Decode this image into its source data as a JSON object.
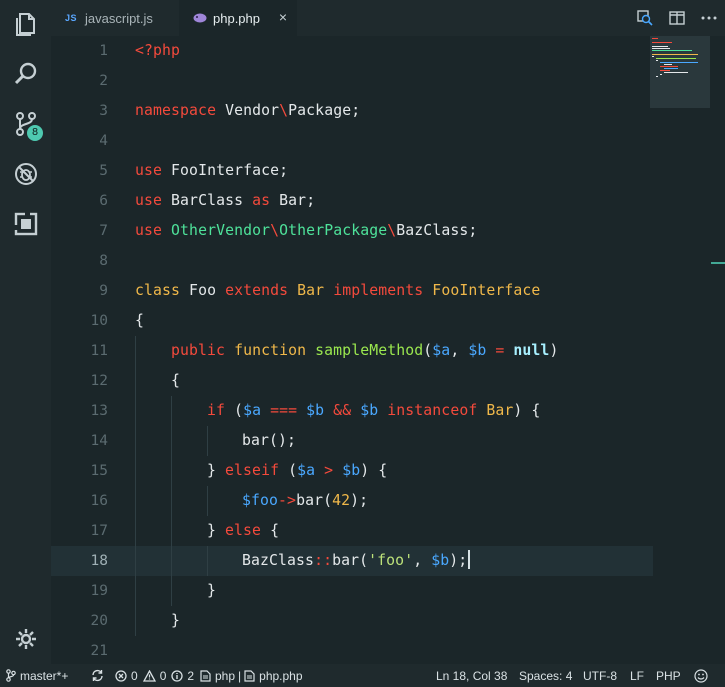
{
  "tabs": [
    {
      "icon": "JS",
      "label": "javascript.js",
      "active": false
    },
    {
      "label": "php.php",
      "active": true,
      "close": "×"
    }
  ],
  "activity": {
    "scm_badge": "8"
  },
  "editor": {
    "lines": [
      {
        "n": "1"
      },
      {
        "n": "2"
      },
      {
        "n": "3"
      },
      {
        "n": "4"
      },
      {
        "n": "5"
      },
      {
        "n": "6"
      },
      {
        "n": "7"
      },
      {
        "n": "8"
      },
      {
        "n": "9"
      },
      {
        "n": "10"
      },
      {
        "n": "11"
      },
      {
        "n": "12"
      },
      {
        "n": "13"
      },
      {
        "n": "14"
      },
      {
        "n": "15"
      },
      {
        "n": "16"
      },
      {
        "n": "17"
      },
      {
        "n": "18"
      },
      {
        "n": "19"
      },
      {
        "n": "20"
      },
      {
        "n": "21"
      }
    ],
    "code": {
      "l1": "<?php",
      "l3_ns": "namespace",
      "l3_name": " Vendor",
      "l3_sep": "\\",
      "l3_pkg": "Package;",
      "l5_use": "use",
      "l5_name": " FooInterface;",
      "l6_use": "use",
      "l6_name": " BarClass ",
      "l6_as": "as",
      "l6_alias": " Bar;",
      "l7_use": "use",
      "l7_a": " OtherVendor",
      "l7_s1": "\\",
      "l7_b": "OtherPackage",
      "l7_s2": "\\",
      "l7_c": "BazClass;",
      "l9_class": "class",
      "l9_name": " Foo ",
      "l9_extends": "extends",
      "l9_bar": " Bar ",
      "l9_impl": "implements",
      "l9_iface": " FooInterface",
      "l10": "{",
      "l11_pub": "public",
      "l11_fn": " function ",
      "l11_name": "sampleMethod",
      "l11_p1": "(",
      "l11_a": "$a",
      "l11_c": ", ",
      "l11_b": "$b",
      "l11_eq": " = ",
      "l11_null": "null",
      "l11_p2": ")",
      "l12": "{",
      "l13_if": "if",
      "l13_p": " (",
      "l13_a": "$a",
      "l13_op": " === ",
      "l13_b": "$b",
      "l13_and": " && ",
      "l13_b2": "$b",
      "l13_inst": " instanceof",
      "l13_bar": " Bar",
      "l13_end": ") {",
      "l14": "bar();",
      "l15_close": "} ",
      "l15_elseif": "elseif",
      "l15_p": " (",
      "l15_a": "$a",
      "l15_op": " > ",
      "l15_b": "$b",
      "l15_end": ") {",
      "l16_foo": "$foo",
      "l16_arrow": "->",
      "l16_bar": "bar(",
      "l16_num": "42",
      "l16_end": ");",
      "l17_close": "} ",
      "l17_else": "else",
      "l17_end": " {",
      "l18_cls": "BazClass",
      "l18_dc": "::",
      "l18_bar": "bar(",
      "l18_str": "'foo'",
      "l18_c": ", ",
      "l18_b": "$b",
      "l18_end": ");",
      "l19": "}",
      "l20": "}"
    }
  },
  "status": {
    "branch": "master*+",
    "errors": "0",
    "warnings": "0",
    "infos": "2",
    "breadcrumb_lang": "php",
    "breadcrumb_sep": "|",
    "breadcrumb_file": "php.php",
    "position": "Ln 18, Col 38",
    "spaces": "Spaces: 4",
    "encoding": "UTF-8",
    "eol": "LF",
    "language": "PHP"
  },
  "colors": {
    "background": "#1b2629",
    "keyword": "#f44a3c",
    "type": "#f0b84a",
    "variable": "#4aa8ff",
    "namespace": "#4ee29a",
    "function": "#9be84f",
    "accent": "#4ec9b0"
  }
}
